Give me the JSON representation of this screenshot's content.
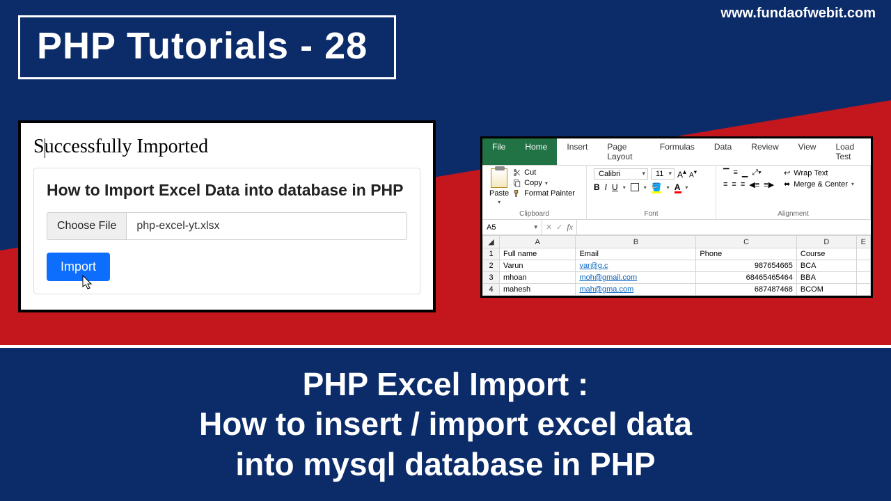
{
  "site_url": "www.fundaofwebit.com",
  "header_title": "PHP Tutorials - 28",
  "left": {
    "success_msg": "Successfully Imported",
    "card_heading": "How to Import Excel Data into database in PHP",
    "choose_label": "Choose File",
    "filename": "php-excel-yt.xlsx",
    "import_label": "Import"
  },
  "excel": {
    "tabs": [
      "File",
      "Home",
      "Insert",
      "Page Layout",
      "Formulas",
      "Data",
      "Review",
      "View",
      "Load Test"
    ],
    "active_tab": 1,
    "clipboard": {
      "cut": "Cut",
      "copy": "Copy",
      "fmtp": "Format Painter",
      "paste": "Paste",
      "label": "Clipboard"
    },
    "font": {
      "name": "Calibri",
      "size": "11",
      "label": "Font"
    },
    "alignment": {
      "wrap": "Wrap Text",
      "merge": "Merge & Center",
      "label": "Alignment"
    },
    "namebox": "A5",
    "cols": [
      "A",
      "B",
      "C",
      "D",
      "E"
    ],
    "headers": [
      "Full name",
      "Email",
      "Phone",
      "Course"
    ],
    "rows": [
      {
        "n": "2",
        "name": "Varun",
        "email": "var@g.c",
        "phone": "987654665",
        "course": "BCA"
      },
      {
        "n": "3",
        "name": "mhoan",
        "email": "moh@gmail.com",
        "phone": "68465465464",
        "course": "BBA"
      },
      {
        "n": "4",
        "name": "mahesh",
        "email": "mah@gma.com",
        "phone": "687487468",
        "course": "BCOM"
      }
    ]
  },
  "footer": {
    "line1": "PHP Excel Import :",
    "line2": "How to insert / import excel data",
    "line3": "into mysql database in PHP"
  }
}
